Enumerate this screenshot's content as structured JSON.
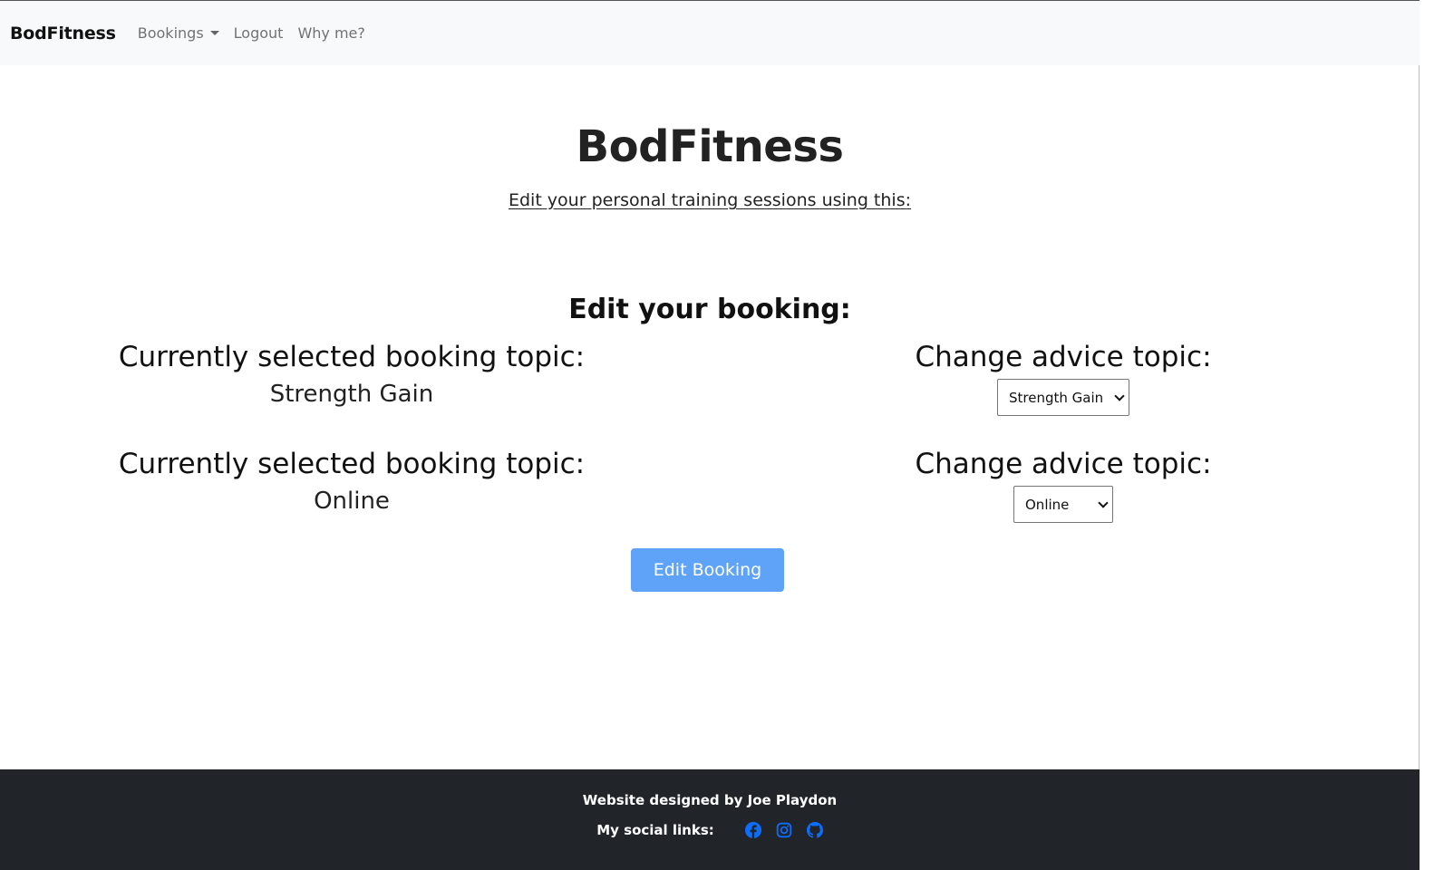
{
  "navbar": {
    "brand": "BodFitness",
    "items": [
      {
        "label": "Bookings",
        "dropdown": true
      },
      {
        "label": "Logout"
      },
      {
        "label": "Why me?"
      }
    ]
  },
  "hero": {
    "title": "BodFitness",
    "subtitle": "Edit your personal training sessions using this:"
  },
  "form": {
    "heading": "Edit your booking:",
    "rows": [
      {
        "current_label": "Currently selected booking topic:",
        "current_value": "Strength Gain",
        "change_label": "Change advice topic:",
        "selected_option": "Strength Gain"
      },
      {
        "current_label": "Currently selected booking topic:",
        "current_value": "Online",
        "change_label": "Change advice topic:",
        "selected_option": "Online"
      }
    ],
    "submit_label": "Edit Booking"
  },
  "footer": {
    "credit": "Website designed by Joe Playdon",
    "social_label": "My social links:",
    "social_icons": [
      "facebook-icon",
      "instagram-icon",
      "github-icon"
    ]
  },
  "colors": {
    "navbar_bg": "#f8f9fa",
    "button_bg": "#5fa3f9",
    "footer_bg": "#212529",
    "social_icon": "#0d6efd"
  }
}
